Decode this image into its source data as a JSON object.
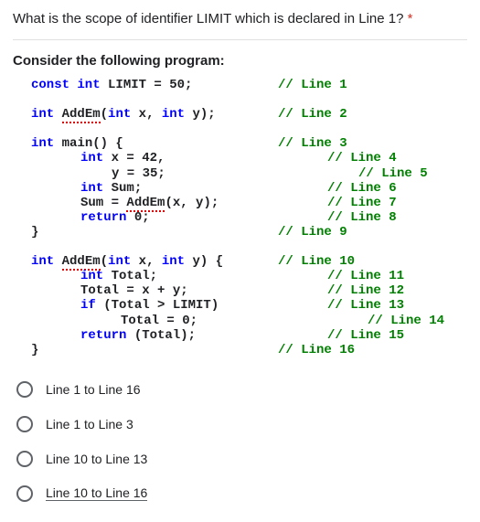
{
  "question": "What is the scope of identifier LIMIT which is declared in Line 1?",
  "required_marker": "*",
  "subheading": "Consider the following program:",
  "code": [
    {
      "indent": 20,
      "segments": [
        {
          "t": "const int",
          "c": "kw"
        },
        {
          "t": " LIMIT = 50;"
        }
      ],
      "comment": "// Line 1"
    },
    {
      "blank": true
    },
    {
      "indent": 20,
      "segments": [
        {
          "t": "int",
          "c": "kw"
        },
        {
          "t": " "
        },
        {
          "t": "AddEm",
          "c": "squiggly"
        },
        {
          "t": "("
        },
        {
          "t": "int",
          "c": "kw"
        },
        {
          "t": " x, "
        },
        {
          "t": "int",
          "c": "kw"
        },
        {
          "t": " y);"
        }
      ],
      "comment": "// Line 2"
    },
    {
      "blank": true
    },
    {
      "indent": 20,
      "segments": [
        {
          "t": "int",
          "c": "kw"
        },
        {
          "t": " main() {"
        }
      ],
      "comment": "// Line 3"
    },
    {
      "indent": 74,
      "segments": [
        {
          "t": "int",
          "c": "kw"
        },
        {
          "t": " x = 42,"
        }
      ],
      "comment": "// Line 4"
    },
    {
      "indent": 108,
      "segments": [
        {
          "t": "y = 35;"
        }
      ],
      "comment": "// Line 5"
    },
    {
      "indent": 74,
      "segments": [
        {
          "t": "int",
          "c": "kw"
        },
        {
          "t": " Sum;"
        }
      ],
      "comment": "// Line 6"
    },
    {
      "indent": 74,
      "segments": [
        {
          "t": "Sum = "
        },
        {
          "t": "AddEm",
          "c": "squiggly"
        },
        {
          "t": "(x, y);"
        }
      ],
      "comment": "// Line 7"
    },
    {
      "indent": 74,
      "segments": [
        {
          "t": "return",
          "c": "kw"
        },
        {
          "t": " 0;"
        }
      ],
      "comment": "// Line 8"
    },
    {
      "indent": 20,
      "segments": [
        {
          "t": "}"
        }
      ],
      "comment": "// Line 9"
    },
    {
      "blank": true
    },
    {
      "indent": 20,
      "segments": [
        {
          "t": "int",
          "c": "kw"
        },
        {
          "t": " "
        },
        {
          "t": "AddEm",
          "c": "squiggly"
        },
        {
          "t": "("
        },
        {
          "t": "int",
          "c": "kw"
        },
        {
          "t": " x, "
        },
        {
          "t": "int",
          "c": "kw"
        },
        {
          "t": " y) {"
        }
      ],
      "comment": "// Line 10"
    },
    {
      "indent": 74,
      "segments": [
        {
          "t": "int",
          "c": "kw"
        },
        {
          "t": " Total;"
        }
      ],
      "comment": "// Line 11"
    },
    {
      "indent": 74,
      "segments": [
        {
          "t": "Total = x + y;"
        }
      ],
      "comment": "// Line 12"
    },
    {
      "indent": 74,
      "segments": [
        {
          "t": "if",
          "c": "kw"
        },
        {
          "t": " (Total > LIMIT)"
        }
      ],
      "comment": "// Line 13"
    },
    {
      "indent": 118,
      "segments": [
        {
          "t": "Total = 0;"
        }
      ],
      "comment": "// Line 14"
    },
    {
      "indent": 74,
      "segments": [
        {
          "t": "return",
          "c": "kw"
        },
        {
          "t": " (Total);"
        }
      ],
      "comment": "// Line 15"
    },
    {
      "indent": 20,
      "segments": [
        {
          "t": "}"
        }
      ],
      "comment": "// Line 16"
    }
  ],
  "options": [
    {
      "label": "Line 1 to Line 16",
      "cut": false
    },
    {
      "label": "Line 1 to Line 3",
      "cut": false
    },
    {
      "label": "Line 10 to Line 13",
      "cut": false
    },
    {
      "label": "Line 10 to Line 16",
      "cut": true
    }
  ]
}
